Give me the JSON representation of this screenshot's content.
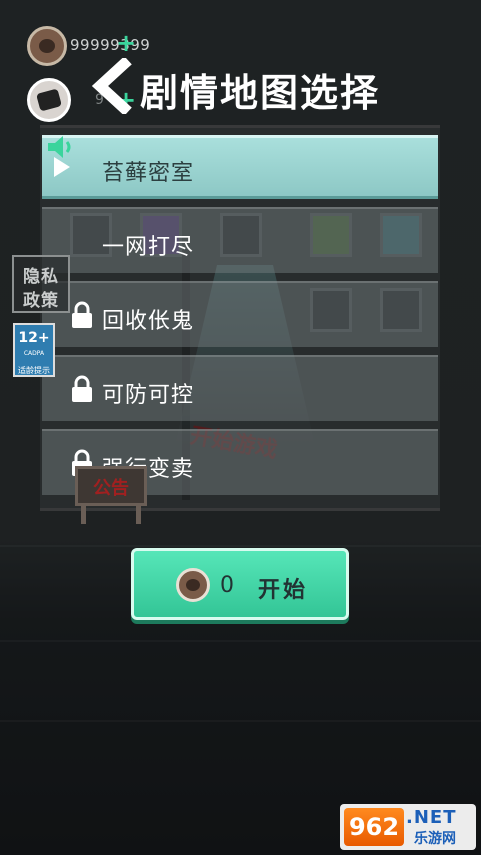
{
  "hud": {
    "coins": "99999399",
    "secondary_value": "9"
  },
  "header": {
    "title": "剧情地图选择"
  },
  "maps": [
    {
      "name": "苔藓密室",
      "locked": false,
      "selected": true
    },
    {
      "name": "一网打尽",
      "locked": false,
      "selected": false
    },
    {
      "name": "回收伥鬼",
      "locked": true,
      "selected": false
    },
    {
      "name": "可防可控",
      "locked": true,
      "selected": false
    },
    {
      "name": "强行变卖",
      "locked": true,
      "selected": false
    }
  ],
  "side": {
    "privacy_line1": "隐私",
    "privacy_line2": "政策",
    "age_rating": "12+",
    "age_org": "CADPA",
    "age_note": "适龄提示"
  },
  "background": {
    "start_sign": "开始游戏",
    "notice_label": "公告"
  },
  "start_button": {
    "cost": "0",
    "label": "开始"
  },
  "watermark": {
    "logo": "962",
    "net": ".NET",
    "site": "乐游网"
  },
  "colors": {
    "accent_green": "#33c596",
    "selected_row": "#a9dfdc",
    "background": "#2b2f2f"
  },
  "icons": [
    "coin-icon",
    "avatar-icon",
    "plus-icon",
    "back-arrow-icon",
    "sound-icon",
    "play-icon",
    "lock-icon"
  ]
}
